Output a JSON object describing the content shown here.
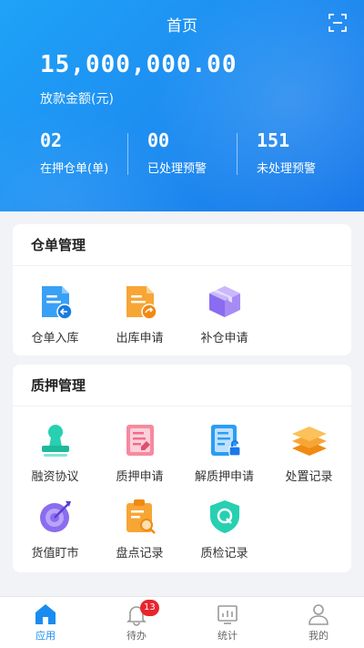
{
  "header": {
    "title": "首页",
    "amount": "15,000,000.00",
    "amount_label": "放款金额(元)",
    "stats": [
      {
        "value": "02",
        "label": "在押仓单(单)"
      },
      {
        "value": "00",
        "label": "已处理预警"
      },
      {
        "value": "151",
        "label": "未处理预警"
      }
    ]
  },
  "warehouse": {
    "title": "仓单管理",
    "items": [
      {
        "label": "仓单入库",
        "icon": "document-in-icon"
      },
      {
        "label": "出库申请",
        "icon": "document-out-icon"
      },
      {
        "label": "补仓申请",
        "icon": "box-icon"
      }
    ]
  },
  "pledge": {
    "title": "质押管理",
    "items": [
      {
        "label": "融资协议",
        "icon": "stamp-icon"
      },
      {
        "label": "质押申请",
        "icon": "form-icon"
      },
      {
        "label": "解质押申请",
        "icon": "unlock-document-icon"
      },
      {
        "label": "处置记录",
        "icon": "layers-icon"
      },
      {
        "label": "货值盯市",
        "icon": "target-icon"
      },
      {
        "label": "盘点记录",
        "icon": "clipboard-search-icon"
      },
      {
        "label": "质检记录",
        "icon": "shield-q-icon"
      }
    ]
  },
  "tabbar": {
    "tabs": [
      {
        "label": "应用",
        "active": true
      },
      {
        "label": "待办",
        "badge": "13"
      },
      {
        "label": "统计"
      },
      {
        "label": "我的"
      }
    ]
  },
  "colors": {
    "primary": "#1a8cf0",
    "badge": "#e8252b",
    "teal": "#26d0b0",
    "orange": "#f7a636",
    "purple": "#8a6cf0",
    "pink": "#f06d8a"
  }
}
